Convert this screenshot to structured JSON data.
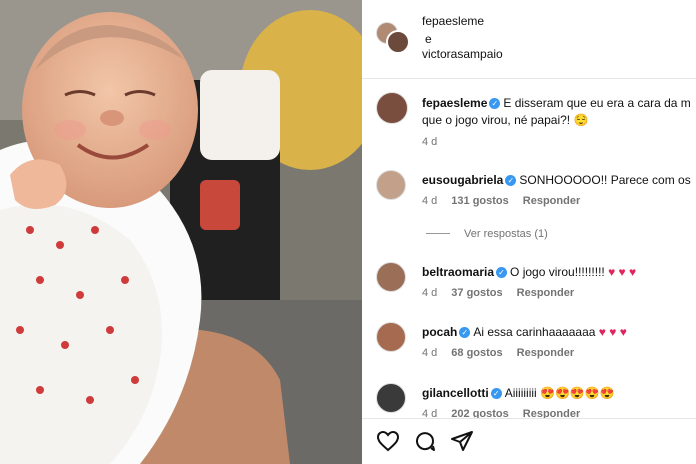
{
  "post": {
    "photo_alt": "baby"
  },
  "header": {
    "user1": "fepaesleme",
    "connector": "e",
    "user2": "victorasampaio"
  },
  "caption": {
    "username": "fepaesleme",
    "text_line1": "E disseram que eu era a cara da m",
    "text_line2": "que o jogo virou, né papai?! 😌",
    "age": "4 d"
  },
  "comments": [
    {
      "username": "eusougabriela",
      "text": "SONHOOOOO!! Parece com os",
      "age": "4 d",
      "likes": "131 gostos",
      "reply": "Responder"
    },
    {
      "username": "beltraomaria",
      "text": "O jogo virou!!!!!!!!!",
      "hearts": "♥ ♥ ♥",
      "age": "4 d",
      "likes": "37 gostos",
      "reply": "Responder"
    },
    {
      "username": "pocah",
      "text": "Ai essa carinhaaaaaaa",
      "hearts": "♥ ♥ ♥",
      "age": "4 d",
      "likes": "68 gostos",
      "reply": "Responder"
    },
    {
      "username": "gilancellotti",
      "text": "Aiiiiiiiii 😍😍😍😍😍",
      "age": "4 d",
      "likes": "202 gostos",
      "reply": "Responder"
    }
  ],
  "view_replies": "Ver respostas (1)",
  "icons": [
    "heart-icon",
    "comment-icon",
    "share-icon"
  ],
  "colors": {
    "verified": "#3897f0",
    "heart": "#e0245e"
  }
}
